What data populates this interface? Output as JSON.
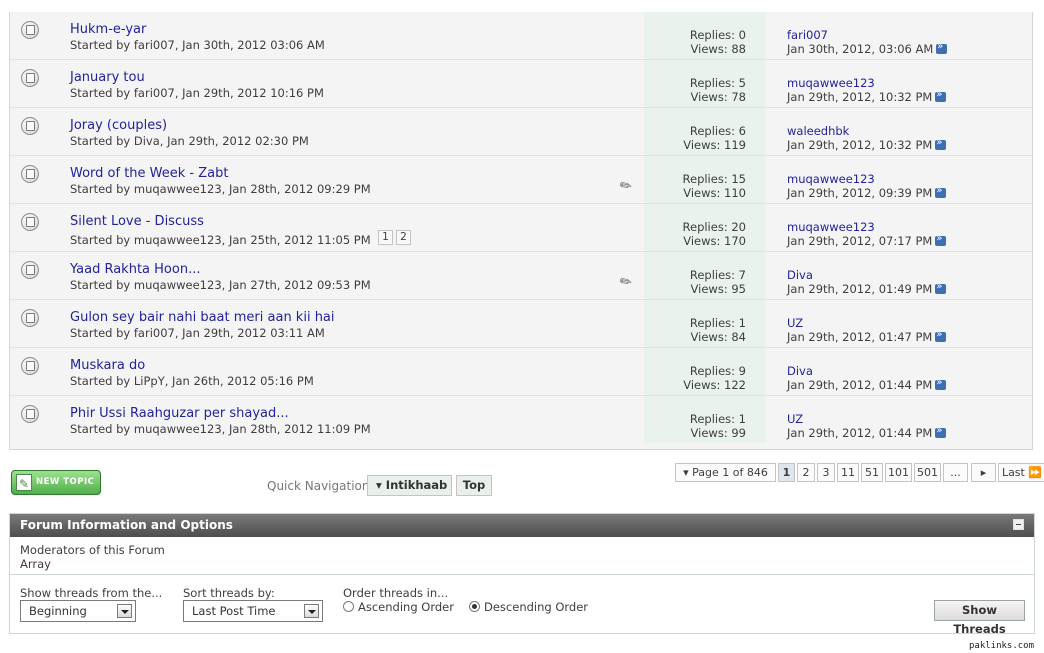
{
  "threads": [
    {
      "title": "Hukm-e-yar",
      "started": "Started by fari007, Jan 30th, 2012 03:06 AM",
      "replies": "Replies: 0",
      "views": "Views: 88",
      "last_user": "fari007",
      "last_date": "Jan 30th, 2012, 03:06 AM",
      "attachment": false,
      "pages": []
    },
    {
      "title": "January tou",
      "started": "Started by fari007, Jan 29th, 2012 10:16 PM",
      "replies": "Replies: 5",
      "views": "Views: 78",
      "last_user": "muqawwee123",
      "last_date": "Jan 29th, 2012, 10:32 PM",
      "attachment": false,
      "pages": []
    },
    {
      "title": "Joray (couples)",
      "started": "Started by Diva, Jan 29th, 2012 02:30 PM",
      "replies": "Replies: 6",
      "views": "Views: 119",
      "last_user": "waleedhbk",
      "last_date": "Jan 29th, 2012, 10:32 PM",
      "attachment": false,
      "pages": []
    },
    {
      "title": "Word of the Week - Zabt",
      "started": "Started by muqawwee123, Jan 28th, 2012 09:29 PM",
      "replies": "Replies: 15",
      "views": "Views: 110",
      "last_user": "muqawwee123",
      "last_date": "Jan 29th, 2012, 09:39 PM",
      "attachment": true,
      "pages": []
    },
    {
      "title": "Silent Love - Discuss",
      "started": "Started by muqawwee123, Jan 25th, 2012 11:05 PM",
      "replies": "Replies: 20",
      "views": "Views: 170",
      "last_user": "muqawwee123",
      "last_date": "Jan 29th, 2012, 07:17 PM",
      "attachment": false,
      "pages": [
        "1",
        "2"
      ]
    },
    {
      "title": "Yaad Rakhta Hoon...",
      "started": "Started by muqawwee123, Jan 27th, 2012 09:53 PM",
      "replies": "Replies: 7",
      "views": "Views: 95",
      "last_user": "Diva",
      "last_date": "Jan 29th, 2012, 01:49 PM",
      "attachment": true,
      "pages": []
    },
    {
      "title": "Gulon sey bair nahi baat meri aan kii hai",
      "started": "Started by fari007, Jan 29th, 2012 03:11 AM",
      "replies": "Replies: 1",
      "views": "Views: 84",
      "last_user": "UZ",
      "last_date": "Jan 29th, 2012, 01:47 PM",
      "attachment": false,
      "pages": []
    },
    {
      "title": "Muskara do",
      "started": "Started by LiPpY, Jan 26th, 2012 05:16 PM",
      "replies": "Replies: 9",
      "views": "Views: 122",
      "last_user": "Diva",
      "last_date": "Jan 29th, 2012, 01:44 PM",
      "attachment": false,
      "pages": []
    },
    {
      "title": "Phir Ussi Raahguzar per shayad...",
      "started": "Started by muqawwee123, Jan 28th, 2012 11:09 PM",
      "replies": "Replies: 1",
      "views": "Views: 99",
      "last_user": "UZ",
      "last_date": "Jan 29th, 2012, 01:44 PM",
      "attachment": false,
      "pages": []
    }
  ],
  "icons": {
    "status": "thread-status-icon",
    "attachment": "paperclip-icon",
    "goto_last": "go-to-last-post-icon",
    "collapse": "collapse-icon"
  },
  "controls": {
    "new_topic": "NEW TOPIC",
    "quick_nav_label": "Quick Navigation",
    "quick_nav_select": "Intikhaab",
    "quick_nav_top": "Top"
  },
  "pagination": {
    "page_of": "▾ Page 1 of 846",
    "pages": [
      "1",
      "2",
      "3",
      "11",
      "51",
      "101",
      "501",
      "..."
    ],
    "current": "1",
    "next": "▸",
    "last": "Last ⏩"
  },
  "forum_info": {
    "header": "Forum Information and Options",
    "moderators_label": "Moderators of this Forum",
    "moderators_value": "Array",
    "show_from_label": "Show threads from the...",
    "show_from_value": "Beginning",
    "sort_label": "Sort threads by:",
    "sort_value": "Last Post Time",
    "order_label": "Order threads in...",
    "ascending": "Ascending Order",
    "descending": "Descending Order",
    "order_selected": "descending",
    "show_button": "Show Threads"
  },
  "watermark": "paklinks.com",
  "colors": {
    "link": "#22229c",
    "stats_bg": "#e9f2eb",
    "header_bg": "#5e5e5e",
    "new_topic": "#5fbe55"
  }
}
